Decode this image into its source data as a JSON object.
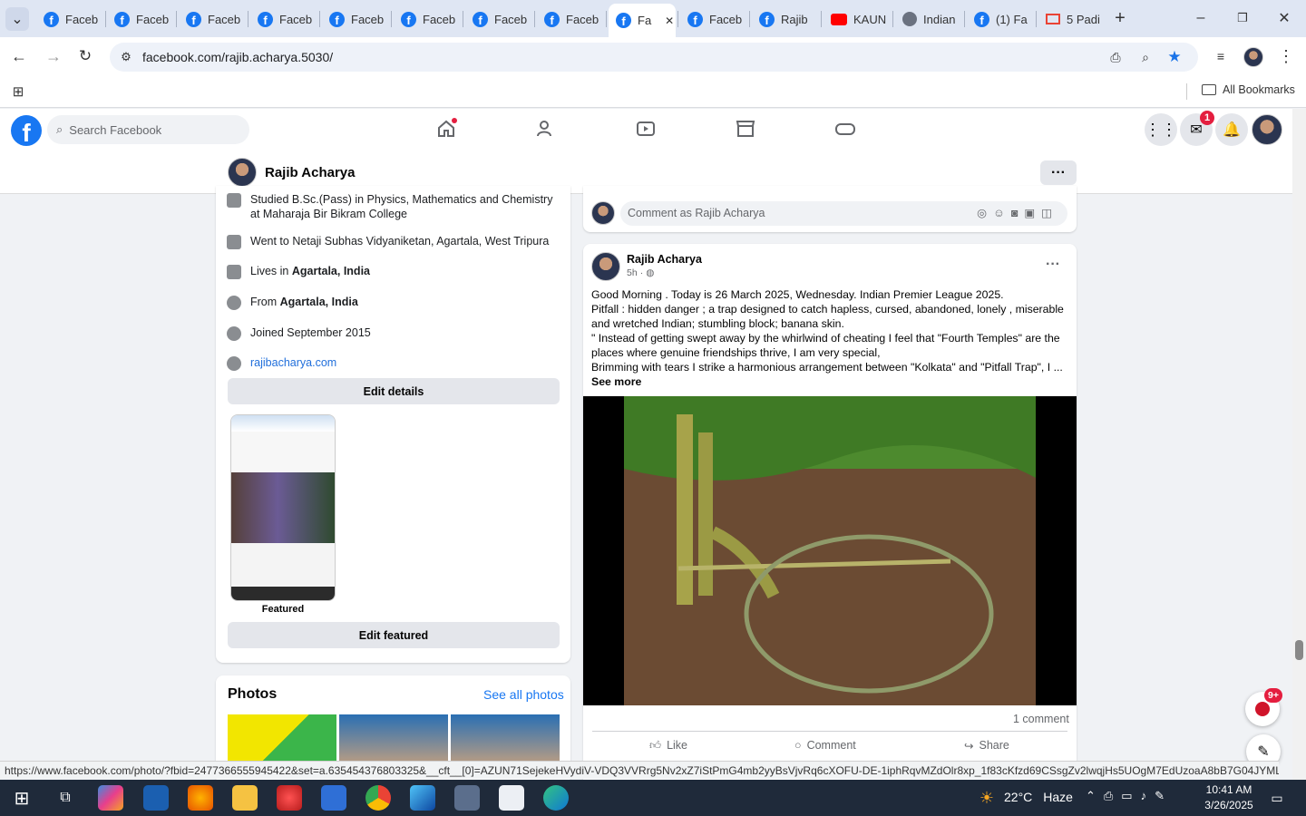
{
  "browser": {
    "tabs": [
      {
        "label": "Faceb",
        "icon": "facebook-icon"
      },
      {
        "label": "Faceb",
        "icon": "facebook-icon"
      },
      {
        "label": "Faceb",
        "icon": "facebook-icon"
      },
      {
        "label": "Faceb",
        "icon": "facebook-icon"
      },
      {
        "label": "Faceb",
        "icon": "facebook-icon"
      },
      {
        "label": "Faceb",
        "icon": "facebook-icon"
      },
      {
        "label": "Faceb",
        "icon": "facebook-icon"
      },
      {
        "label": "Faceb",
        "icon": "facebook-icon"
      },
      {
        "label": "Fa",
        "icon": "facebook-icon",
        "active": true
      },
      {
        "label": "Faceb",
        "icon": "facebook-icon"
      },
      {
        "label": "Rajib",
        "icon": "facebook-icon"
      },
      {
        "label": "KAUN",
        "icon": "youtube-icon"
      },
      {
        "label": "Indian",
        "icon": "globe-icon"
      },
      {
        "label": "(1) Fa",
        "icon": "facebook-icon"
      },
      {
        "label": "5 Padi",
        "icon": "gmail-icon"
      }
    ],
    "url": "facebook.com/rajib.acharya.5030/",
    "bookmarks_label": "All Bookmarks"
  },
  "fb": {
    "search_placeholder": "Search Facebook",
    "messenger_badge": "1",
    "profile_name": "Rajib Acharya"
  },
  "intro": {
    "items": [
      {
        "text": "Studied B.Sc.(Pass) in Physics, Mathematics and Chemistry at Maharaja Bir Bikram College",
        "icon": "education-icon"
      },
      {
        "text": "Went to Netaji Subhas Vidyaniketan, Agartala, West Tripura",
        "icon": "education-icon"
      },
      {
        "prefix": "Lives in ",
        "bold": "Agartala, India",
        "icon": "home-icon"
      },
      {
        "prefix": "From ",
        "bold": "Agartala, India",
        "icon": "location-icon"
      },
      {
        "text": "Joined September 2015",
        "icon": "clock-icon"
      },
      {
        "link": "rajibacharya.com",
        "icon": "globe-icon"
      }
    ],
    "edit_details": "Edit details",
    "featured_label": "Featured",
    "edit_featured": "Edit featured"
  },
  "photos": {
    "title": "Photos",
    "see_all": "See all photos"
  },
  "post": {
    "comment_placeholder": "Comment as Rajib Acharya",
    "author": "Rajib Acharya",
    "time": "5h",
    "lines": [
      "Good Morning . Today is 26 March 2025, Wednesday. Indian Premier League 2025.",
      "Pitfall : hidden danger ; a trap designed to catch hapless, cursed, abandoned, lonely , miserable and wretched Indian; stumbling block; banana skin.",
      "\" Instead of getting swept away by the whirlwind of cheating I feel that \"Fourth Temples\" are the places where genuine friendships thrive, I am very special,",
      "Brimming with tears I strike a harmonious arrangement between \"Kolkata\" and \"Pitfall Trap\", I ..."
    ],
    "see_more": "See more",
    "comment_count": "1 comment",
    "like": "Like",
    "comment": "Comment",
    "share": "Share"
  },
  "status_url": "https://www.facebook.com/photo/?fbid=2477366555945422&set=a.635454376803325&__cft__[0]=AZUN71SejekeHVydiV-VDQ3VVRrg5Nv2xZ7iStPmG4mb2yyBsVjvRq6cXOFU-DE-1iphRqvMZdOlr8xp_1f83cKfzd69CSsgZv2lwqjHs5UOgM7EdUzoaA8bB7G04JYMLox...",
  "chat_badge": "9+",
  "taskbar": {
    "weather": "22°C",
    "weather_desc": "Haze",
    "time": "10:41 AM",
    "date": "3/26/2025"
  }
}
